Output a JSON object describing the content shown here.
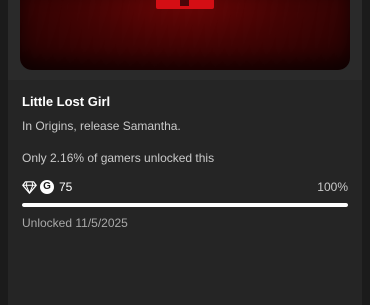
{
  "achievement": {
    "title": "Little Lost Girl",
    "description": "In Origins, release Samantha.",
    "rarity_text": "Only 2.16% of gamers unlocked this",
    "gamerscore": "75",
    "gamerscore_badge": "G",
    "progress_text": "100%",
    "progress_value": 1.0,
    "unlocked_text": "Unlocked 11/5/2025"
  },
  "icons": {
    "rarity": "diamond-icon",
    "gamerscore": "gamerscore-icon"
  },
  "colors": {
    "card_background": "#252525",
    "page_background": "#1b1b1b",
    "art_red": "#d40e14",
    "progress_fill": "#ffffff",
    "progress_track": "#4a4a4a"
  }
}
